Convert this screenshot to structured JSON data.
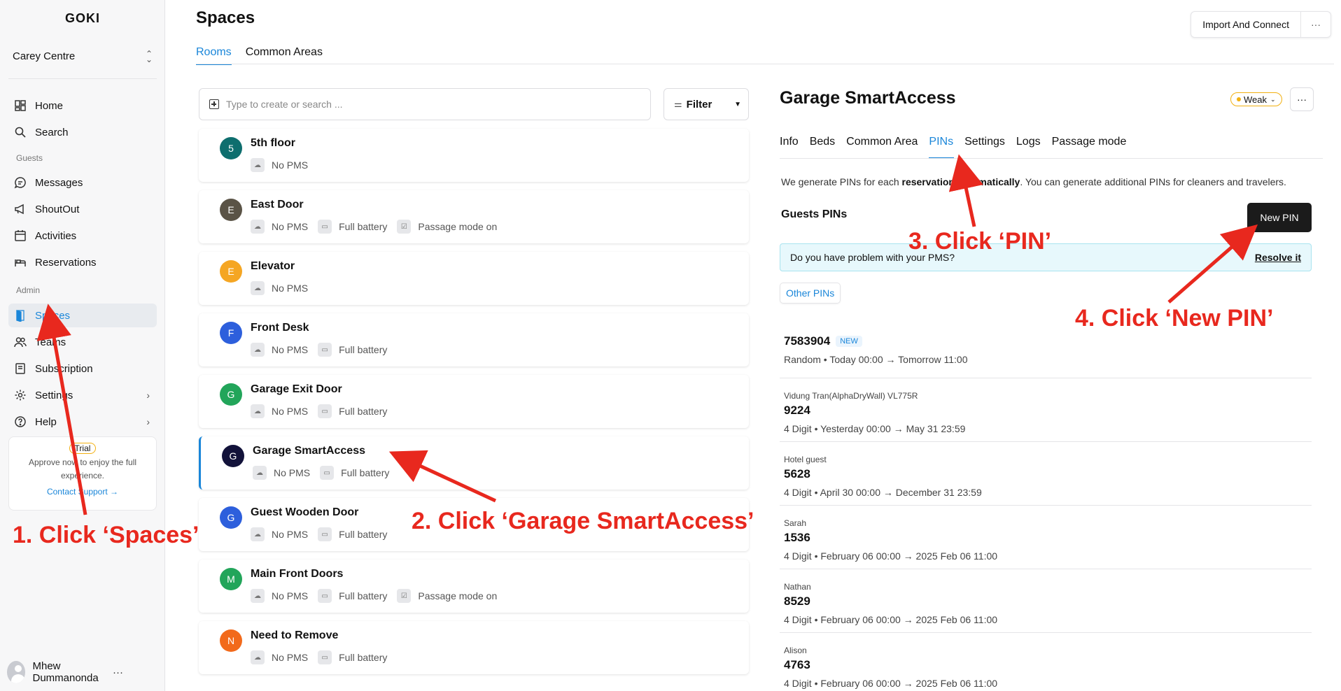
{
  "sidebar": {
    "logo": "GOKI",
    "org": "Carey Centre",
    "items": [
      {
        "label": "Home"
      },
      {
        "label": "Search"
      },
      {
        "label": "Messages"
      },
      {
        "label": "ShoutOut"
      },
      {
        "label": "Activities"
      },
      {
        "label": "Reservations"
      },
      {
        "label": "Spaces"
      },
      {
        "label": "Teams"
      },
      {
        "label": "Subscription"
      },
      {
        "label": "Settings"
      },
      {
        "label": "Help"
      }
    ],
    "section_guests": "Guests",
    "section_admin": "Admin",
    "trial": {
      "badge": "Trial",
      "text": "Approve now to enjoy the full experience.",
      "link": "Contact Support →"
    },
    "user": "Mhew Dummanonda"
  },
  "header": {
    "title": "Spaces",
    "tabs": [
      "Rooms",
      "Common Areas"
    ],
    "import_label": "Import And Connect"
  },
  "search": {
    "placeholder": "Type to create or search ..."
  },
  "filter": {
    "label": "Filter"
  },
  "rooms": [
    {
      "initial": "5",
      "name": "5th floor",
      "color": "#0e6e6e",
      "tags": [
        "No PMS"
      ]
    },
    {
      "initial": "E",
      "name": "East Door",
      "color": "#5a5346",
      "tags": [
        "No PMS",
        "Full battery",
        "Passage mode on"
      ]
    },
    {
      "initial": "E",
      "name": "Elevator",
      "color": "#f5a623",
      "tags": [
        "No PMS"
      ]
    },
    {
      "initial": "F",
      "name": "Front Desk",
      "color": "#2d5fdc",
      "tags": [
        "No PMS",
        "Full battery"
      ]
    },
    {
      "initial": "G",
      "name": "Garage Exit Door",
      "color": "#22a55a",
      "tags": [
        "No PMS",
        "Full battery"
      ]
    },
    {
      "initial": "G",
      "name": "Garage SmartAccess",
      "color": "#12123a",
      "tags": [
        "No PMS",
        "Full battery"
      ]
    },
    {
      "initial": "G",
      "name": "Guest Wooden Door",
      "color": "#2d5fdc",
      "tags": [
        "No PMS",
        "Full battery"
      ]
    },
    {
      "initial": "M",
      "name": "Main Front Doors",
      "color": "#22a55a",
      "tags": [
        "No PMS",
        "Full battery",
        "Passage mode on"
      ]
    },
    {
      "initial": "N",
      "name": "Need to Remove",
      "color": "#f26a1b",
      "tags": [
        "No PMS",
        "Full battery"
      ]
    }
  ],
  "detail": {
    "title": "Garage SmartAccess",
    "signal": "Weak",
    "tabs": [
      "Info",
      "Beds",
      "Common Area",
      "PINs",
      "Settings",
      "Logs",
      "Passage mode"
    ],
    "note_pre": "We generate PINs for each ",
    "note_bold": "reservation automatically",
    "note_post": ". You can generate additional PINs for cleaners and travelers.",
    "guests_label": "Guests PINs",
    "new_pin": "New PIN",
    "alert_text": "Do you have problem with your PMS?",
    "alert_link": "Resolve it",
    "other_pins": "Other PINs",
    "new_badge": "NEW",
    "pins": [
      {
        "owner": "",
        "code": "7583904",
        "meta": "Random • Today 00:00 → Tomorrow 11:00"
      },
      {
        "owner": "Vidung Tran(AlphaDryWall) VL775R",
        "code": "9224",
        "meta": "4 Digit • Yesterday 00:00 → May 31 23:59"
      },
      {
        "owner": "Hotel guest",
        "code": "5628",
        "meta": "4 Digit • April 30 00:00 → December 31 23:59"
      },
      {
        "owner": "Sarah",
        "code": "1536",
        "meta": "4 Digit • February 06 00:00 → 2025 Feb 06 11:00"
      },
      {
        "owner": "Nathan",
        "code": "8529",
        "meta": "4 Digit • February 06 00:00 → 2025 Feb 06 11:00"
      },
      {
        "owner": "Alison",
        "code": "4763",
        "meta": "4 Digit • February 06 00:00 → 2025 Feb 06 11:00"
      }
    ]
  },
  "annotations": [
    "1. Click ‘Spaces’",
    "2. Click ‘Garage SmartAccess’",
    "3. Click ‘PIN’",
    "4. Click ‘New PIN’"
  ],
  "colors": {
    "accent": "#1a86d9",
    "annotation": "#e8281e"
  }
}
